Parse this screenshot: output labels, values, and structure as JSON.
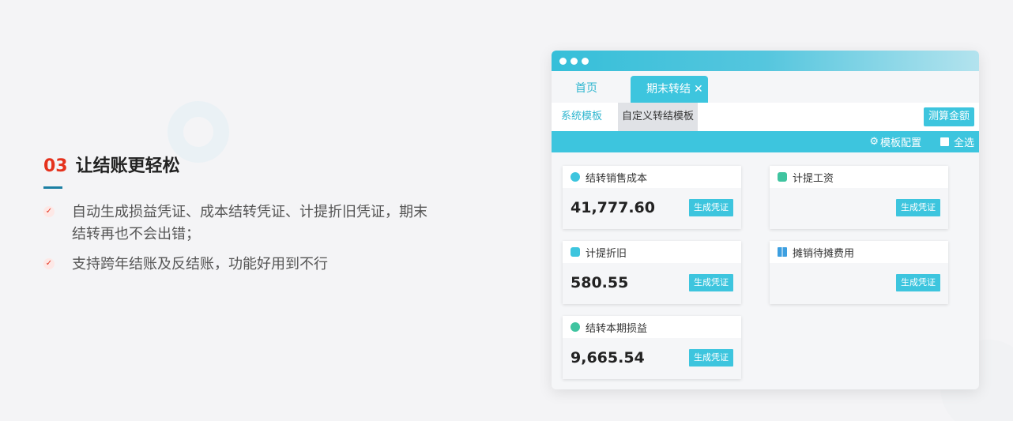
{
  "feature": {
    "number": "03",
    "title": "让结账更轻松",
    "bullets": [
      "自动生成损益凭证、成本结转凭证、计提折旧凭证，期末结转再也不会出错；",
      "支持跨年结账及反结账，功能好用到不行"
    ]
  },
  "window": {
    "tabs": {
      "home": "首页",
      "active": "期末转结",
      "close": "✕"
    },
    "subtabs": {
      "system": "系统模板",
      "custom": "自定义转结模板"
    },
    "measure_button": "测算金额",
    "toolbar": {
      "template_config": "模板配置",
      "select_all": "全选"
    },
    "cards": [
      {
        "title": "结转销售成本",
        "value": "41,777.60",
        "button": "生成凭证",
        "icon": "coin-bag-icon",
        "color": "#3dc5de"
      },
      {
        "title": "计提工资",
        "value": "",
        "button": "生成凭证",
        "icon": "payroll-icon",
        "color": "#3fc4a0"
      },
      {
        "title": "计提折旧",
        "value": "580.55",
        "button": "生成凭证",
        "icon": "depreciation-icon",
        "color": "#3dc5de"
      },
      {
        "title": "摊销待摊费用",
        "value": "",
        "button": "生成凭证",
        "icon": "grid-icon",
        "color": "#3d9fe0"
      },
      {
        "title": "结转本期损益",
        "value": "9,665.54",
        "button": "生成凭证",
        "icon": "profit-bag-icon",
        "color": "#3fc4a0"
      }
    ]
  },
  "colors": {
    "accent": "#3dc5de",
    "brand_red": "#e5321d"
  }
}
